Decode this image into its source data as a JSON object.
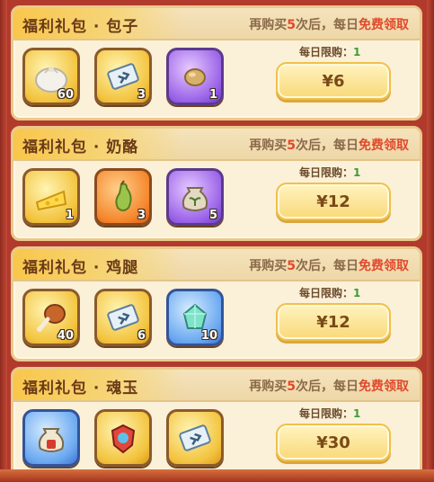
{
  "cards": [
    {
      "title": "福利礼包 · 包子",
      "promo_pre": "再购买",
      "promo_num": "5",
      "promo_mid": "次后，每日",
      "promo_free": "免费领取",
      "limit_label": "每日限购：",
      "limit_num": "1",
      "price": "¥6",
      "items": [
        {
          "icon": "steamed-bun-icon",
          "qty": "60",
          "bg": "gold"
        },
        {
          "icon": "scroll-icon",
          "qty": "3",
          "bg": "gold"
        },
        {
          "icon": "bean-icon",
          "qty": "1",
          "bg": "purple"
        }
      ]
    },
    {
      "title": "福利礼包 · 奶酪",
      "promo_pre": "再购买",
      "promo_num": "5",
      "promo_mid": "次后，每日",
      "promo_free": "免费领取",
      "limit_label": "每日限购：",
      "limit_num": "1",
      "price": "¥12",
      "items": [
        {
          "icon": "cheese-icon",
          "qty": "1",
          "bg": "gold"
        },
        {
          "icon": "gourd-icon",
          "qty": "3",
          "bg": "orange"
        },
        {
          "icon": "seed-bag-icon",
          "qty": "5",
          "bg": "purple"
        }
      ]
    },
    {
      "title": "福利礼包 · 鸡腿",
      "promo_pre": "再购买",
      "promo_num": "5",
      "promo_mid": "次后，每日",
      "promo_free": "免费领取",
      "limit_label": "每日限购：",
      "limit_num": "1",
      "price": "¥12",
      "items": [
        {
          "icon": "chicken-leg-icon",
          "qty": "40",
          "bg": "gold"
        },
        {
          "icon": "scroll-icon",
          "qty": "6",
          "bg": "gold"
        },
        {
          "icon": "crystal-icon",
          "qty": "10",
          "bg": "blue"
        }
      ]
    },
    {
      "title": "福利礼包 · 魂玉",
      "promo_pre": "再购买",
      "promo_num": "5",
      "promo_mid": "次后，每日",
      "promo_free": "免费领取",
      "limit_label": "每日限购：",
      "limit_num": "1",
      "price": "¥30",
      "items": [
        {
          "icon": "mystery-bag-icon",
          "qty": "",
          "bg": "blue"
        },
        {
          "icon": "gem-shield-icon",
          "qty": "",
          "bg": "gold"
        },
        {
          "icon": "scroll-icon",
          "qty": "",
          "bg": "gold"
        }
      ]
    }
  ]
}
